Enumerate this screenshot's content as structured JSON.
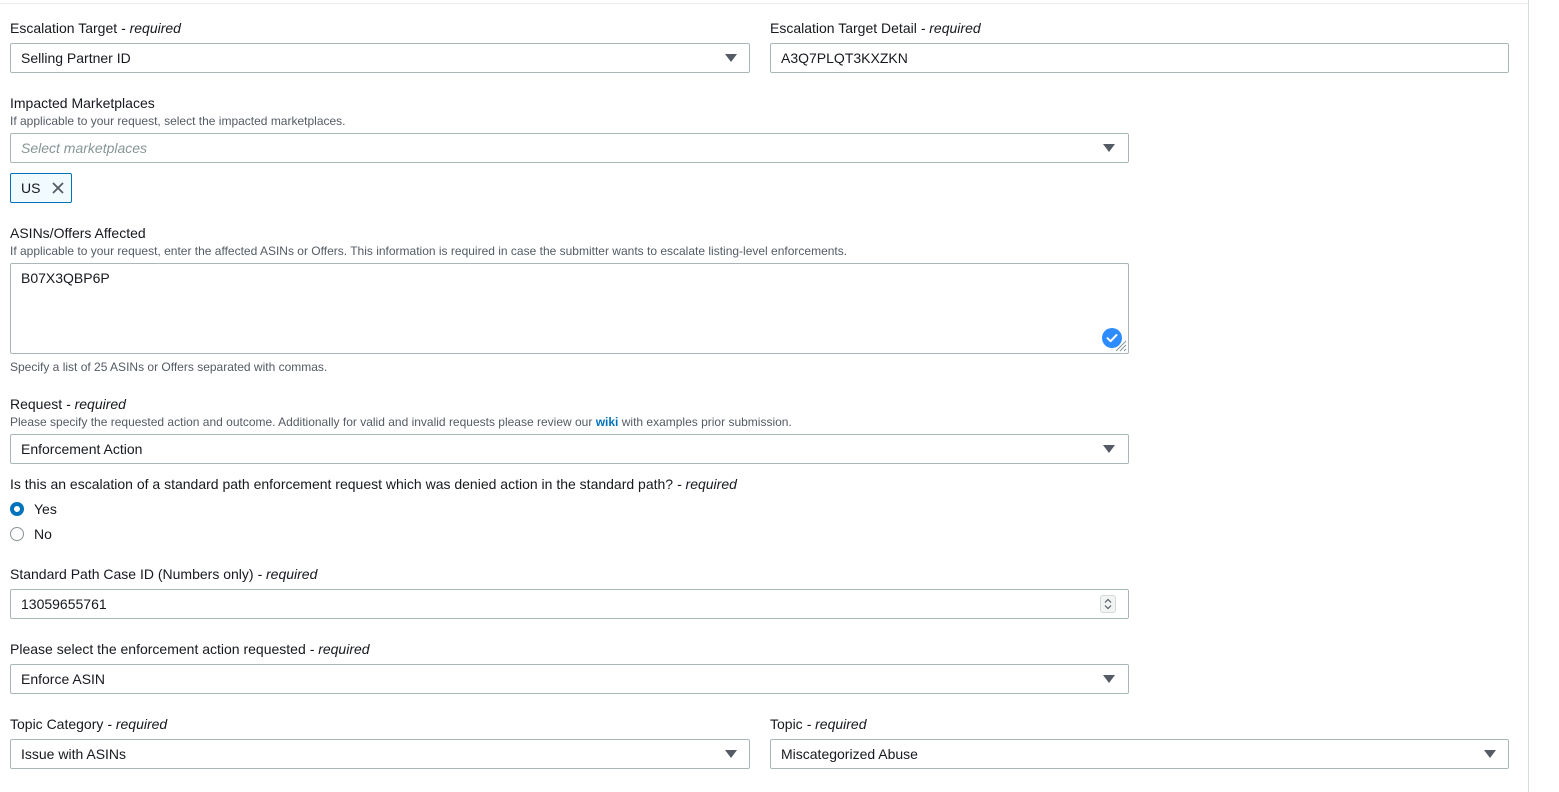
{
  "escalation_target": {
    "label": "Escalation Target",
    "required": "- required",
    "value": "Selling Partner ID"
  },
  "escalation_target_detail": {
    "label": "Escalation Target Detail",
    "required": "- required",
    "value": "A3Q7PLQT3KXZKN"
  },
  "impacted_marketplaces": {
    "label": "Impacted Marketplaces",
    "hint": "If applicable to your request, select the impacted marketplaces.",
    "placeholder": "Select marketplaces",
    "tokens": [
      "US"
    ]
  },
  "asins": {
    "label": "ASINs/Offers Affected",
    "hint": "If applicable to your request, enter the affected ASINs or Offers. This information is required in case the submitter wants to escalate listing-level enforcements.",
    "value": "B07X3QBP6P",
    "constraint": "Specify a list of 25 ASINs or Offers separated with commas."
  },
  "request": {
    "label": "Request",
    "required": "- required",
    "hint_before": "Please specify the requested action and outcome. Additionally for valid and invalid requests please review our",
    "hint_link": "wiki",
    "hint_after": "with examples prior submission.",
    "value": "Enforcement Action"
  },
  "escalation_question": {
    "label": "Is this an escalation of a standard path enforcement request which was denied action in the standard path?",
    "required": "- required",
    "options": [
      "Yes",
      "No"
    ],
    "selected": "Yes"
  },
  "case_id": {
    "label": "Standard Path Case ID (Numbers only)",
    "required": "- required",
    "value": "13059655761"
  },
  "enforcement_action": {
    "label": "Please select the enforcement action requested",
    "required": "- required",
    "value": "Enforce ASIN"
  },
  "topic_category": {
    "label": "Topic Category",
    "required": "- required",
    "value": "Issue with ASINs"
  },
  "topic": {
    "label": "Topic",
    "required": "- required",
    "value": "Miscategorized Abuse"
  },
  "colors": {
    "accent": "#0073bb",
    "border": "#aab7b8",
    "hint_text": "#545b64",
    "validation_badge": "#2d8cff"
  }
}
